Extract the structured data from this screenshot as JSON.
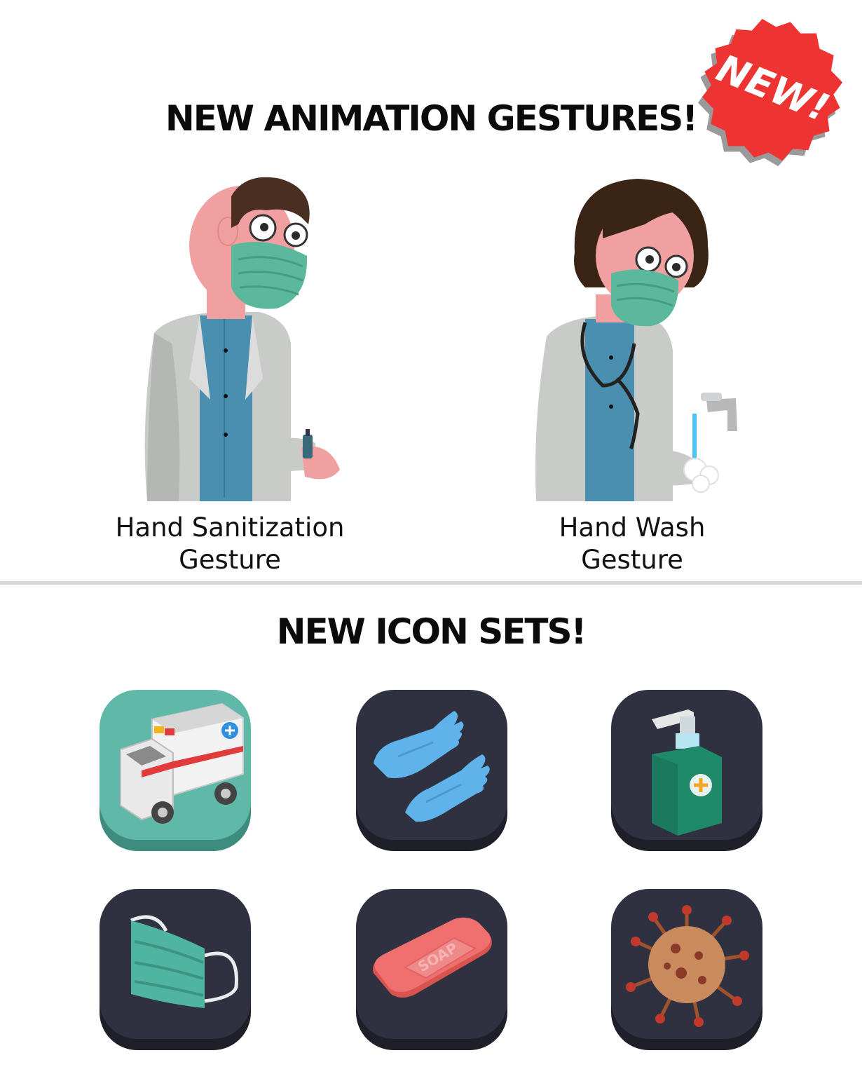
{
  "gestures_section": {
    "title": "NEW ANIMATION GESTURES!",
    "badge": "NEW!",
    "items": [
      {
        "label_line1": "Hand Sanitization",
        "label_line2": "Gesture",
        "icon": "doctor-sanitizing-hands"
      },
      {
        "label_line1": "Hand Wash",
        "label_line2": "Gesture",
        "icon": "doctor-washing-hands"
      }
    ]
  },
  "icons_section": {
    "title": "NEW ICON SETS!",
    "icons": [
      {
        "icon": "ambulance-icon"
      },
      {
        "icon": "gloves-icon"
      },
      {
        "icon": "sanitizer-bottle-icon"
      },
      {
        "icon": "face-mask-icon"
      },
      {
        "icon": "soap-bar-icon",
        "text": "SOAP"
      },
      {
        "icon": "virus-icon"
      }
    ]
  },
  "colors": {
    "badge_red": "#ee3333",
    "tile_teal": "#5fb8a8",
    "tile_dark": "#2f3140",
    "mask_green": "#5bb89c",
    "coat_gray": "#c9cbc9",
    "shirt_blue": "#4a8fb0",
    "skin_pink": "#f0a0a0"
  }
}
